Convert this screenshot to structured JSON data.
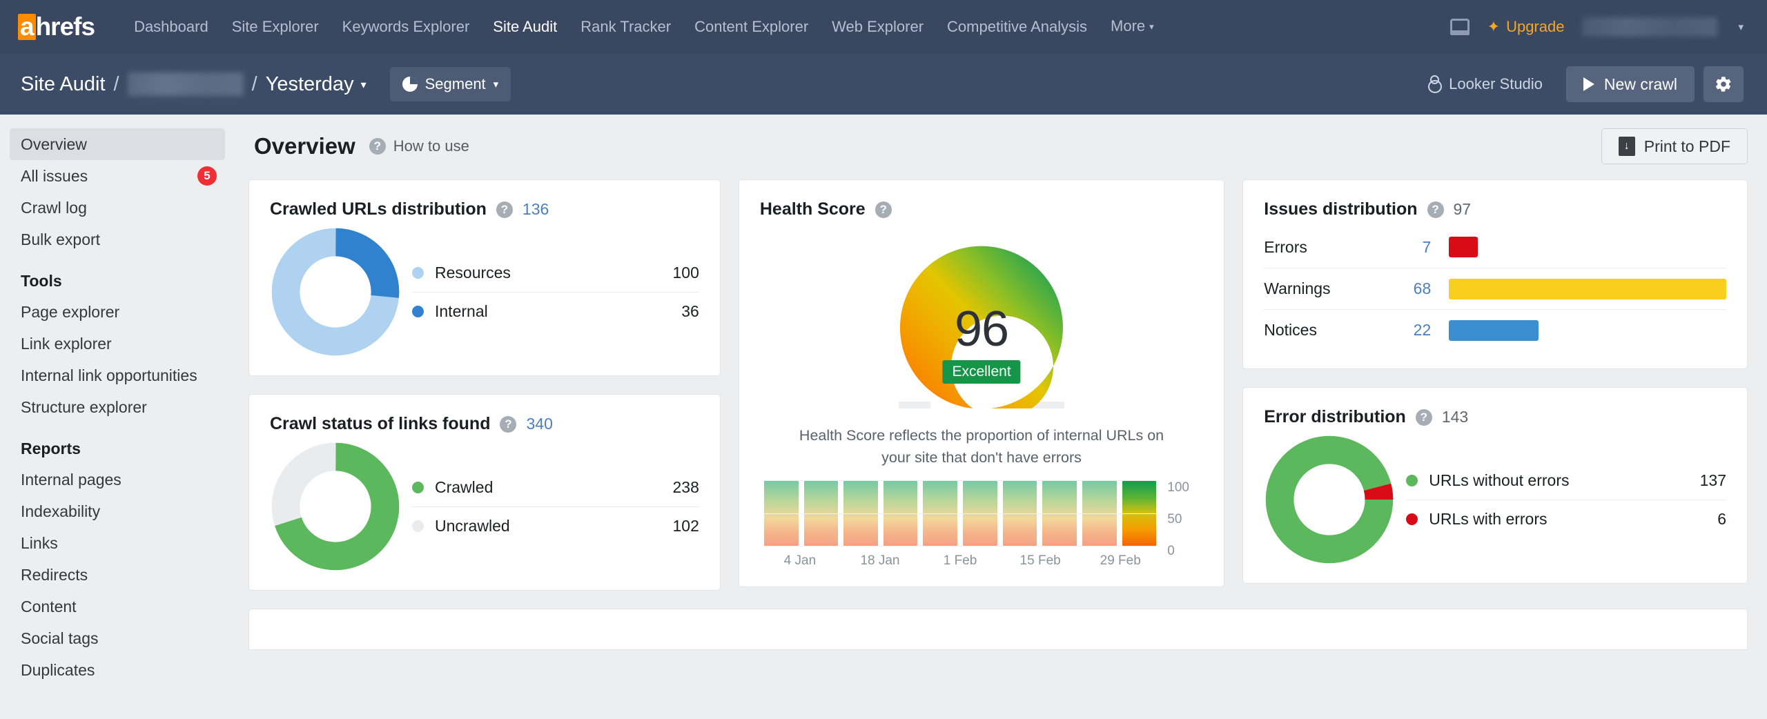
{
  "topnav": {
    "logo": {
      "accent": "a",
      "rest": "hrefs"
    },
    "links": [
      {
        "label": "Dashboard",
        "active": false
      },
      {
        "label": "Site Explorer",
        "active": false
      },
      {
        "label": "Keywords Explorer",
        "active": false
      },
      {
        "label": "Site Audit",
        "active": true
      },
      {
        "label": "Rank Tracker",
        "active": false
      },
      {
        "label": "Content Explorer",
        "active": false
      },
      {
        "label": "Web Explorer",
        "active": false
      },
      {
        "label": "Competitive Analysis",
        "active": false
      },
      {
        "label": "More",
        "active": false,
        "caret": "▾"
      }
    ],
    "upgrade_label": "Upgrade",
    "sparkle_icon": "✦",
    "user_caret": "▾"
  },
  "subheader": {
    "breadcrumb_root": "Site Audit",
    "separator": "/",
    "date_label": "Yesterday",
    "date_caret": "▾",
    "segment_label": "Segment",
    "segment_caret": "▾",
    "looker_label": "Looker Studio",
    "new_crawl_label": "New crawl",
    "gear_icon": "⚙"
  },
  "sidebar": {
    "items": [
      {
        "label": "Overview",
        "active": true,
        "badge": null
      },
      {
        "label": "All issues",
        "active": false,
        "badge": "5"
      },
      {
        "label": "Crawl log",
        "active": false,
        "badge": null
      },
      {
        "label": "Bulk export",
        "active": false,
        "badge": null
      }
    ],
    "tools_heading": "Tools",
    "tools": [
      {
        "label": "Page explorer"
      },
      {
        "label": "Link explorer"
      },
      {
        "label": "Internal link opportunities"
      },
      {
        "label": "Structure explorer"
      }
    ],
    "reports_heading": "Reports",
    "reports": [
      {
        "label": "Internal pages"
      },
      {
        "label": "Indexability"
      },
      {
        "label": "Links"
      },
      {
        "label": "Redirects"
      },
      {
        "label": "Content"
      },
      {
        "label": "Social tags"
      },
      {
        "label": "Duplicates"
      }
    ]
  },
  "main": {
    "page_title": "Overview",
    "how_to_use": "How to use",
    "print_pdf": "Print to PDF",
    "help_glyph": "?"
  },
  "chart_data": [
    {
      "type": "pie",
      "title": "Crawled URLs distribution",
      "total": "136",
      "labels": [
        "Resources",
        "Internal"
      ],
      "values": [
        100,
        36
      ],
      "colors": [
        "#aed2ef",
        "#3182ce"
      ],
      "legend": "right"
    },
    {
      "type": "pie",
      "title": "Crawl status of links found",
      "total": "340",
      "labels": [
        "Crawled",
        "Uncrawled"
      ],
      "values": [
        238,
        102
      ],
      "colors": [
        "#5cb85c",
        "#e9ecef"
      ],
      "legend": "right"
    },
    {
      "type": "bar",
      "title": "Health Score",
      "score": "96",
      "score_label": "Excellent",
      "description": "Health Score reflects the proportion of internal URLs on your site that don't have errors",
      "categories": [
        "4 Jan",
        "18 Jan",
        "1 Feb",
        "15 Feb",
        "29 Feb"
      ],
      "values": [
        100,
        100,
        100,
        100,
        100,
        100,
        100,
        100,
        100,
        100
      ],
      "bar_count": 10,
      "highlight_index": 9,
      "ylim": [
        0,
        100
      ],
      "yticks": [
        "100",
        "50",
        "0"
      ],
      "gauge_max": 100,
      "gauge_value": 96
    },
    {
      "type": "bar",
      "title": "Issues distribution",
      "total": "97",
      "categories": [
        "Errors",
        "Warnings",
        "Notices"
      ],
      "values": [
        7,
        68,
        22
      ],
      "colors": [
        "#d90b17",
        "#f7cf1c",
        "#3b8ed0"
      ],
      "orientation": "horizontal"
    },
    {
      "type": "pie",
      "title": "Error distribution",
      "total": "143",
      "labels": [
        "URLs without errors",
        "URLs with errors"
      ],
      "values": [
        137,
        6
      ],
      "colors": [
        "#5cb85c",
        "#d90b17"
      ],
      "legend": "right"
    }
  ]
}
